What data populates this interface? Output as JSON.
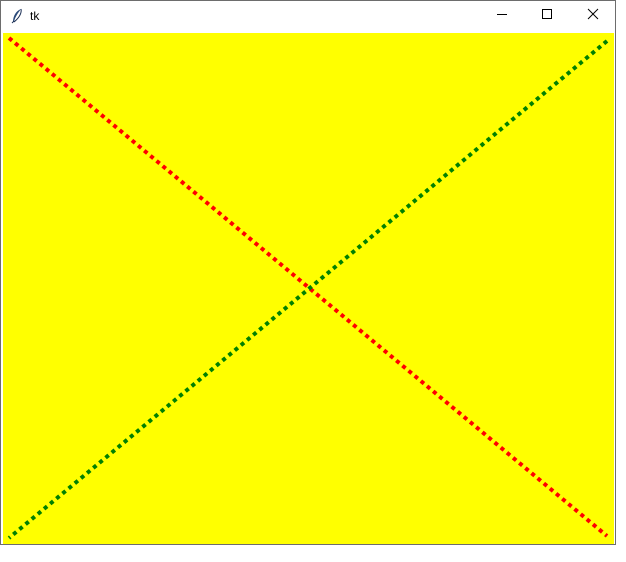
{
  "window": {
    "title": "tk",
    "app_icon": "feather-icon",
    "controls": {
      "minimize_icon": "minimize-icon",
      "maximize_icon": "maximize-icon",
      "close_icon": "close-icon"
    }
  },
  "canvas": {
    "background": "#ffff00",
    "lines": [
      {
        "name": "red-diagonal-line",
        "color": "#ff0000",
        "style": "dotted"
      },
      {
        "name": "green-diagonal-line",
        "color": "#008000",
        "style": "dotted"
      }
    ]
  }
}
